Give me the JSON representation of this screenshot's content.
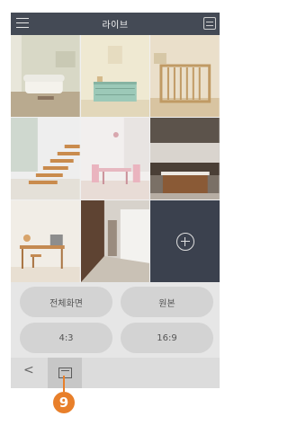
{
  "header": {
    "title": "라이브",
    "menu_icon": "hamburger-icon",
    "layout_icon": "layout-icon"
  },
  "grid": {
    "cells": [
      {
        "scene": "living-room-sofa"
      },
      {
        "scene": "green-dresser"
      },
      {
        "scene": "baby-crib"
      },
      {
        "scene": "staircase"
      },
      {
        "scene": "dining-room"
      },
      {
        "scene": "kitchen"
      },
      {
        "scene": "study-desk"
      },
      {
        "scene": "hallway"
      },
      {
        "scene": "add-camera"
      }
    ]
  },
  "controls": {
    "fullscreen": "전체화면",
    "original": "원본",
    "ratio_4_3": "4:3",
    "ratio_16_9": "16:9"
  },
  "bottombar": {
    "back": "<",
    "view_icon": "screen-icon"
  },
  "callout": {
    "number": "9"
  },
  "colors": {
    "header": "#444a55",
    "add_cell": "#3b414e",
    "callout": "#e87f2a"
  }
}
